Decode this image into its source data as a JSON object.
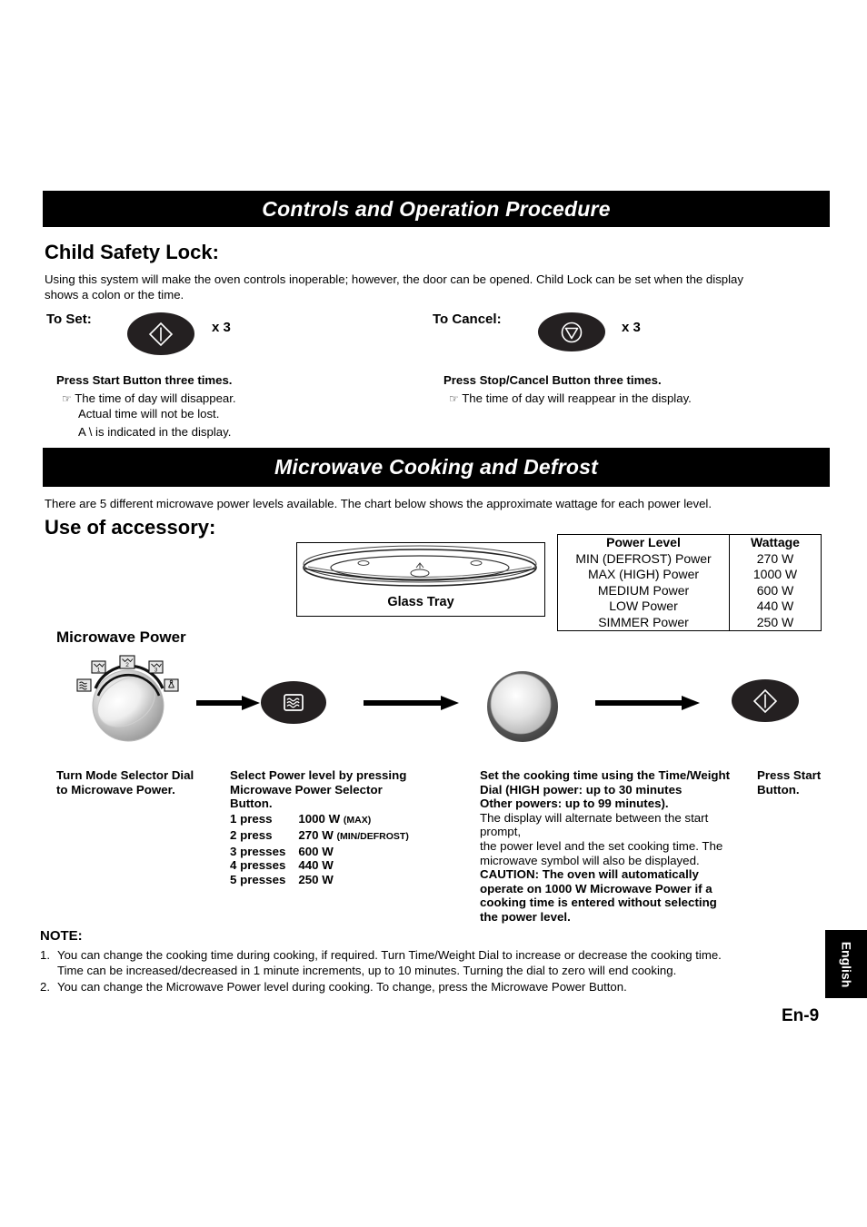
{
  "sections": {
    "controls_header": "Controls and Operation Procedure",
    "microwave_header": "Microwave Cooking and Defrost"
  },
  "child_safety": {
    "title": "Child Safety Lock:",
    "intro_line1": "Using this system will make the oven controls inoperable; however, the door can be opened. Child Lock can be set when the display",
    "intro_line2": "shows a colon or the time.",
    "to_set": {
      "label": "To Set:",
      "multiplier": "x 3",
      "button_icon": "start-diamond-icon",
      "instruction": "Press Start Button three times.",
      "bullets": [
        "The time of day will disappear.",
        "Actual time will not be lost.",
        "A \\ is indicated in the display."
      ]
    },
    "to_cancel": {
      "label": "To Cancel:",
      "multiplier": "x 3",
      "button_icon": "stop-cancel-icon",
      "instruction": "Press Stop/Cancel Button three times.",
      "bullets": [
        "The time of day will reappear in the display."
      ]
    }
  },
  "microwave": {
    "intro": "There are 5 different microwave power levels available. The chart below shows the approximate wattage for each power level.",
    "accessory_title": "Use of accessory:",
    "tray_caption": "Glass Tray",
    "power_title": "Microwave Power"
  },
  "power_table": {
    "headers": [
      "Power Level",
      "Wattage"
    ],
    "rows": [
      {
        "level": "MIN (DEFROST) Power",
        "wattage": "270 W"
      },
      {
        "level": "MAX (HIGH) Power",
        "wattage": "1000 W"
      },
      {
        "level": "MEDIUM Power",
        "wattage": "600 W"
      },
      {
        "level": "LOW Power",
        "wattage": "440 W"
      },
      {
        "level": "SIMMER Power",
        "wattage": "250 W"
      }
    ]
  },
  "steps": {
    "step1": {
      "line1": "Turn Mode Selector Dial",
      "line2": "to Microwave Power."
    },
    "step2": {
      "line1": "Select Power level by pressing",
      "line2": "Microwave Power Selector",
      "line3": "Button.",
      "presses": [
        {
          "count": "1 press",
          "value": "1000 W",
          "suffix": "(MAX)"
        },
        {
          "count": "2 press",
          "value": "270 W",
          "suffix": "(MIN/DEFROST)"
        },
        {
          "count": "3 presses",
          "value": "600 W",
          "suffix": ""
        },
        {
          "count": "4 presses",
          "value": "440 W",
          "suffix": ""
        },
        {
          "count": "5 presses",
          "value": "250 W",
          "suffix": ""
        }
      ]
    },
    "step3": {
      "bold1": "Set the cooking time using the Time/Weight",
      "bold2": "Dial (HIGH power: up to 30 minutes",
      "bold3": "Other powers: up to 99 minutes).",
      "plain1": "The display will alternate between the start prompt,",
      "plain2": "the power level and the set cooking time. The",
      "plain3": "microwave symbol will also be displayed.",
      "caution1": "CAUTION: The oven will automatically",
      "caution2": "operate on 1000 W Microwave Power if a",
      "caution3": "cooking time is entered without selecting",
      "caution4": "the power level."
    },
    "step4": {
      "line1": "Press Start",
      "line2": "Button."
    }
  },
  "note": {
    "title": "NOTE:",
    "items": [
      {
        "num": "1.",
        "line1": "You can change the cooking time during cooking, if required. Turn Time/Weight Dial to increase or decrease the cooking time.",
        "line2": "Time can be increased/decreased in 1 minute increments, up to 10 minutes. Turning the dial to zero will end cooking."
      },
      {
        "num": "2.",
        "line1": "You can change the Microwave Power level during cooking. To change, press the Microwave Power Button.",
        "line2": ""
      }
    ]
  },
  "footer": {
    "language_tab": "English",
    "page_number": "En-9"
  },
  "colors": {
    "bar_bg": "#000000",
    "bar_text": "#ffffff",
    "button_bg": "#242021",
    "page_bg": "#ffffff"
  }
}
